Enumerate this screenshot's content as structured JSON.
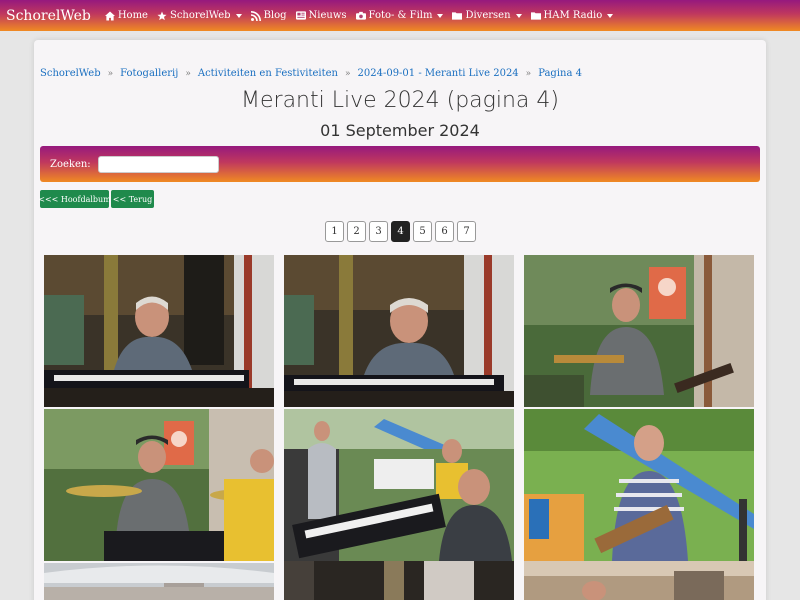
{
  "navbar": {
    "brand": "SchorelWeb",
    "items": [
      {
        "label": "Home",
        "icon": "home-icon",
        "dropdown": false
      },
      {
        "label": "SchorelWeb",
        "icon": "star-icon",
        "dropdown": true
      },
      {
        "label": "Blog",
        "icon": "rss-icon",
        "dropdown": false
      },
      {
        "label": "Nieuws",
        "icon": "newspaper-icon",
        "dropdown": false
      },
      {
        "label": "Foto- & Film",
        "icon": "camera-icon",
        "dropdown": true
      },
      {
        "label": "Diversen",
        "icon": "folder-icon",
        "dropdown": true
      },
      {
        "label": "HAM Radio",
        "icon": "folder-icon",
        "dropdown": true
      }
    ]
  },
  "breadcrumb": [
    "SchorelWeb",
    "Fotogallerij",
    "Activiteiten en Festiviteiten",
    "2024-09-01 - Meranti Live 2024",
    "Pagina 4"
  ],
  "page": {
    "title": "Meranti Live 2024 (pagina 4)",
    "date": "01 September 2024"
  },
  "search": {
    "label": "Zoeken:",
    "value": ""
  },
  "buttons": {
    "album": "<<< Hoofdalbum",
    "back": "<< Terug"
  },
  "pagination": {
    "pages": [
      "1",
      "2",
      "3",
      "4",
      "5",
      "6",
      "7"
    ],
    "current": "4"
  },
  "colors": {
    "gradient_top": "#96197e",
    "gradient_bottom": "#f08a22",
    "button_green": "#1f8a4c",
    "link_blue": "#1a6fc0"
  }
}
